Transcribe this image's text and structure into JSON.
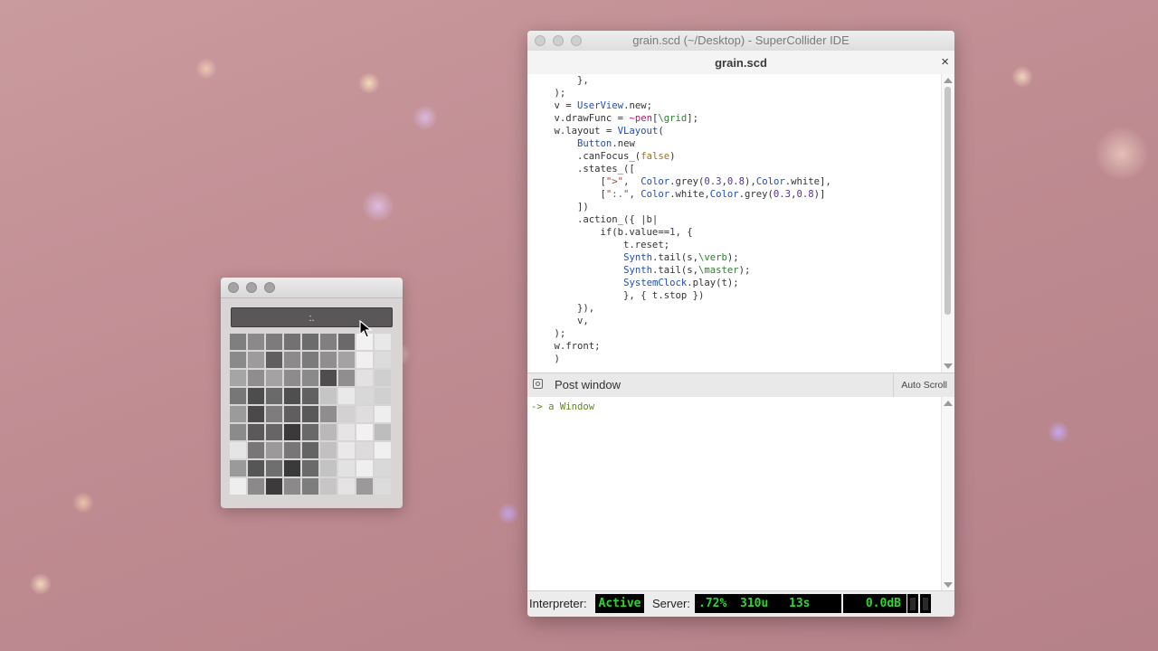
{
  "grid_window": {
    "button_label": ":.",
    "cells": [
      [
        "#7f7f7f",
        "#8a8a8a",
        "#7c7c7c",
        "#727272",
        "#6c6c6c",
        "#808080",
        "#6a6a6a",
        "#f2f2f2",
        "#e8e8e8"
      ],
      [
        "#8a8a8a",
        "#9c9c9c",
        "#5f5f5f",
        "#8b8b8b",
        "#7b7b7b",
        "#8f8f8f",
        "#a3a3a3",
        "#f0f0f0",
        "#dcdcdc"
      ],
      [
        "#a5a5a5",
        "#8e8e8e",
        "#a3a3a3",
        "#8c8c8c",
        "#8a8a8a",
        "#4e4e4e",
        "#8f8f8f",
        "#e2e2e2",
        "#cfcfcf"
      ],
      [
        "#777777",
        "#4d4d4d",
        "#6a6a6a",
        "#4f4f4f",
        "#616161",
        "#c5c5c5",
        "#e9e9e9",
        "#d8d8d8",
        "#d0d0d0"
      ],
      [
        "#9b9b9b",
        "#4a4a4a",
        "#7d7d7d",
        "#5f5f5f",
        "#595959",
        "#8e8e8e",
        "#d2d2d2",
        "#dedede",
        "#eeeeee"
      ],
      [
        "#8b8b8b",
        "#5a5a5a",
        "#666666",
        "#3a3a3a",
        "#696969",
        "#b9b9b9",
        "#e5e5e5",
        "#f2f2f2",
        "#bdbdbd"
      ],
      [
        "#e5e5e5",
        "#777777",
        "#9a9a9a",
        "#777777",
        "#646464",
        "#c1c1c1",
        "#e9e9e9",
        "#dcdcdc",
        "#f0f0f0"
      ],
      [
        "#9a9a9a",
        "#565656",
        "#6f6f6f",
        "#3a3a3a",
        "#6a6a6a",
        "#c3c3c3",
        "#e2e2e2",
        "#efefef",
        "#d9d9d9"
      ],
      [
        "#eeeeee",
        "#8a8a8a",
        "#3b3b3b",
        "#8a8a8a",
        "#7d7d7d",
        "#c6c6c6",
        "#e4e4e4",
        "#9a9a9a",
        "#dcdcdc"
      ]
    ]
  },
  "ide": {
    "window_title": "grain.scd (~/Desktop) - SuperCollider IDE",
    "tab_label": "grain.scd",
    "close_symbol": "×",
    "code_lines": [
      [
        {
          "t": "        },"
        }
      ],
      [
        {
          "t": "    );"
        }
      ],
      [
        {
          "t": "    v = "
        },
        {
          "t": "UserView",
          "c": "class-tok"
        },
        {
          "t": ".new;"
        }
      ],
      [
        {
          "t": "    v.drawFunc = "
        },
        {
          "t": "~pen",
          "c": "env-tok"
        },
        {
          "t": "["
        },
        {
          "t": "\\grid",
          "c": "sym-tok"
        },
        {
          "t": "];"
        }
      ],
      [
        {
          "t": "    w.layout = "
        },
        {
          "t": "VLayout",
          "c": "class-tok"
        },
        {
          "t": "("
        }
      ],
      [
        {
          "t": "        "
        },
        {
          "t": "Button",
          "c": "class-tok"
        },
        {
          "t": ".new"
        }
      ],
      [
        {
          "t": "        .canFocus_("
        },
        {
          "t": "false",
          "c": "kw-tok"
        },
        {
          "t": ")"
        }
      ],
      [
        {
          "t": "        .states_(["
        }
      ],
      [
        {
          "t": "            ["
        },
        {
          "t": "\">\"",
          "c": "str-tok"
        },
        {
          "t": ",  "
        },
        {
          "t": "Color",
          "c": "class-tok"
        },
        {
          "t": ".grey("
        },
        {
          "t": "0.3",
          "c": "num-tok"
        },
        {
          "t": ","
        },
        {
          "t": "0.8",
          "c": "num-tok"
        },
        {
          "t": "),"
        },
        {
          "t": "Color",
          "c": "class-tok"
        },
        {
          "t": ".white],"
        }
      ],
      [
        {
          "t": "            ["
        },
        {
          "t": "\":.\"",
          "c": "str-tok"
        },
        {
          "t": ", "
        },
        {
          "t": "Color",
          "c": "class-tok"
        },
        {
          "t": ".white,"
        },
        {
          "t": "Color",
          "c": "class-tok"
        },
        {
          "t": ".grey("
        },
        {
          "t": "0.3",
          "c": "num-tok"
        },
        {
          "t": ","
        },
        {
          "t": "0.8",
          "c": "num-tok"
        },
        {
          "t": ")]"
        }
      ],
      [
        {
          "t": "        ])"
        }
      ],
      [
        {
          "t": "        .action_({ |b|"
        }
      ],
      [
        {
          "t": "            if(b.value=="
        },
        {
          "t": "1",
          "c": "num-tok"
        },
        {
          "t": ", {"
        }
      ],
      [
        {
          "t": "                t.reset;"
        }
      ],
      [
        {
          "t": "                "
        },
        {
          "t": "Synth",
          "c": "class-tok"
        },
        {
          "t": ".tail(s,"
        },
        {
          "t": "\\verb",
          "c": "sym-tok"
        },
        {
          "t": ");"
        }
      ],
      [
        {
          "t": "                "
        },
        {
          "t": "Synth",
          "c": "class-tok"
        },
        {
          "t": ".tail(s,"
        },
        {
          "t": "\\master",
          "c": "sym-tok"
        },
        {
          "t": ");"
        }
      ],
      [
        {
          "t": "                "
        },
        {
          "t": "SystemClock",
          "c": "class-tok"
        },
        {
          "t": ".play(t);"
        }
      ],
      [
        {
          "t": "                }, { t.stop })"
        }
      ],
      [
        {
          "t": "        }),"
        }
      ],
      [
        {
          "t": "        v,"
        }
      ],
      [
        {
          "t": "    );"
        }
      ],
      [
        {
          "t": "    w.front;"
        }
      ],
      [
        {
          "t": "    )"
        }
      ]
    ]
  },
  "post_window": {
    "title": "Post window",
    "autoscroll_label": "Auto Scroll",
    "lines": [
      "-> a Window"
    ]
  },
  "status": {
    "interpreter_label": "Interpreter:",
    "interpreter_state": "Active",
    "server_label": "Server:",
    "cpu": ".72%",
    "ugens": "310u",
    "time": "13s",
    "volume": "0.0dB",
    "text_color": "#2ed52e"
  }
}
